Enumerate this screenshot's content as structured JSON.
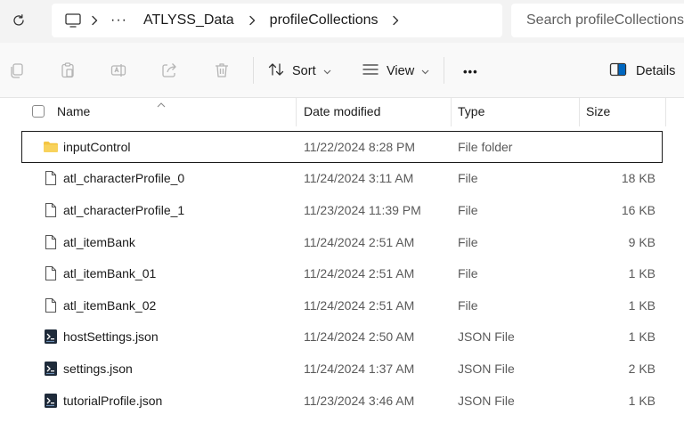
{
  "addressbar": {
    "refresh_icon": "refresh-icon",
    "pc_icon": "computer-icon",
    "overflow": "···",
    "breadcrumbs": [
      "ATLYSS_Data",
      "profileCollections"
    ],
    "search_placeholder": "Search profileCollections"
  },
  "commandbar": {
    "sort_label": "Sort",
    "view_label": "View",
    "more_label": "•••",
    "details_label": "Details"
  },
  "columns": {
    "name": "Name",
    "date": "Date modified",
    "type": "Type",
    "size": "Size"
  },
  "files": [
    {
      "icon": "folder",
      "name": "inputControl",
      "date": "11/22/2024 8:28 PM",
      "type": "File folder",
      "size": "",
      "selected": true
    },
    {
      "icon": "file",
      "name": "atl_characterProfile_0",
      "date": "11/24/2024 3:11 AM",
      "type": "File",
      "size": "18 KB"
    },
    {
      "icon": "file",
      "name": "atl_characterProfile_1",
      "date": "11/23/2024 11:39 PM",
      "type": "File",
      "size": "16 KB"
    },
    {
      "icon": "file",
      "name": "atl_itemBank",
      "date": "11/24/2024 2:51 AM",
      "type": "File",
      "size": "9 KB"
    },
    {
      "icon": "file",
      "name": "atl_itemBank_01",
      "date": "11/24/2024 2:51 AM",
      "type": "File",
      "size": "1 KB"
    },
    {
      "icon": "file",
      "name": "atl_itemBank_02",
      "date": "11/24/2024 2:51 AM",
      "type": "File",
      "size": "1 KB"
    },
    {
      "icon": "json",
      "name": "hostSettings.json",
      "date": "11/24/2024 2:50 AM",
      "type": "JSON File",
      "size": "1 KB"
    },
    {
      "icon": "json",
      "name": "settings.json",
      "date": "11/24/2024 1:37 AM",
      "type": "JSON File",
      "size": "2 KB"
    },
    {
      "icon": "json",
      "name": "tutorialProfile.json",
      "date": "11/23/2024 3:46 AM",
      "type": "JSON File",
      "size": "1 KB"
    }
  ],
  "colors": {
    "folder": "#f4c542",
    "json_icon": "#1f2b3a",
    "accent": "#0067c0"
  }
}
